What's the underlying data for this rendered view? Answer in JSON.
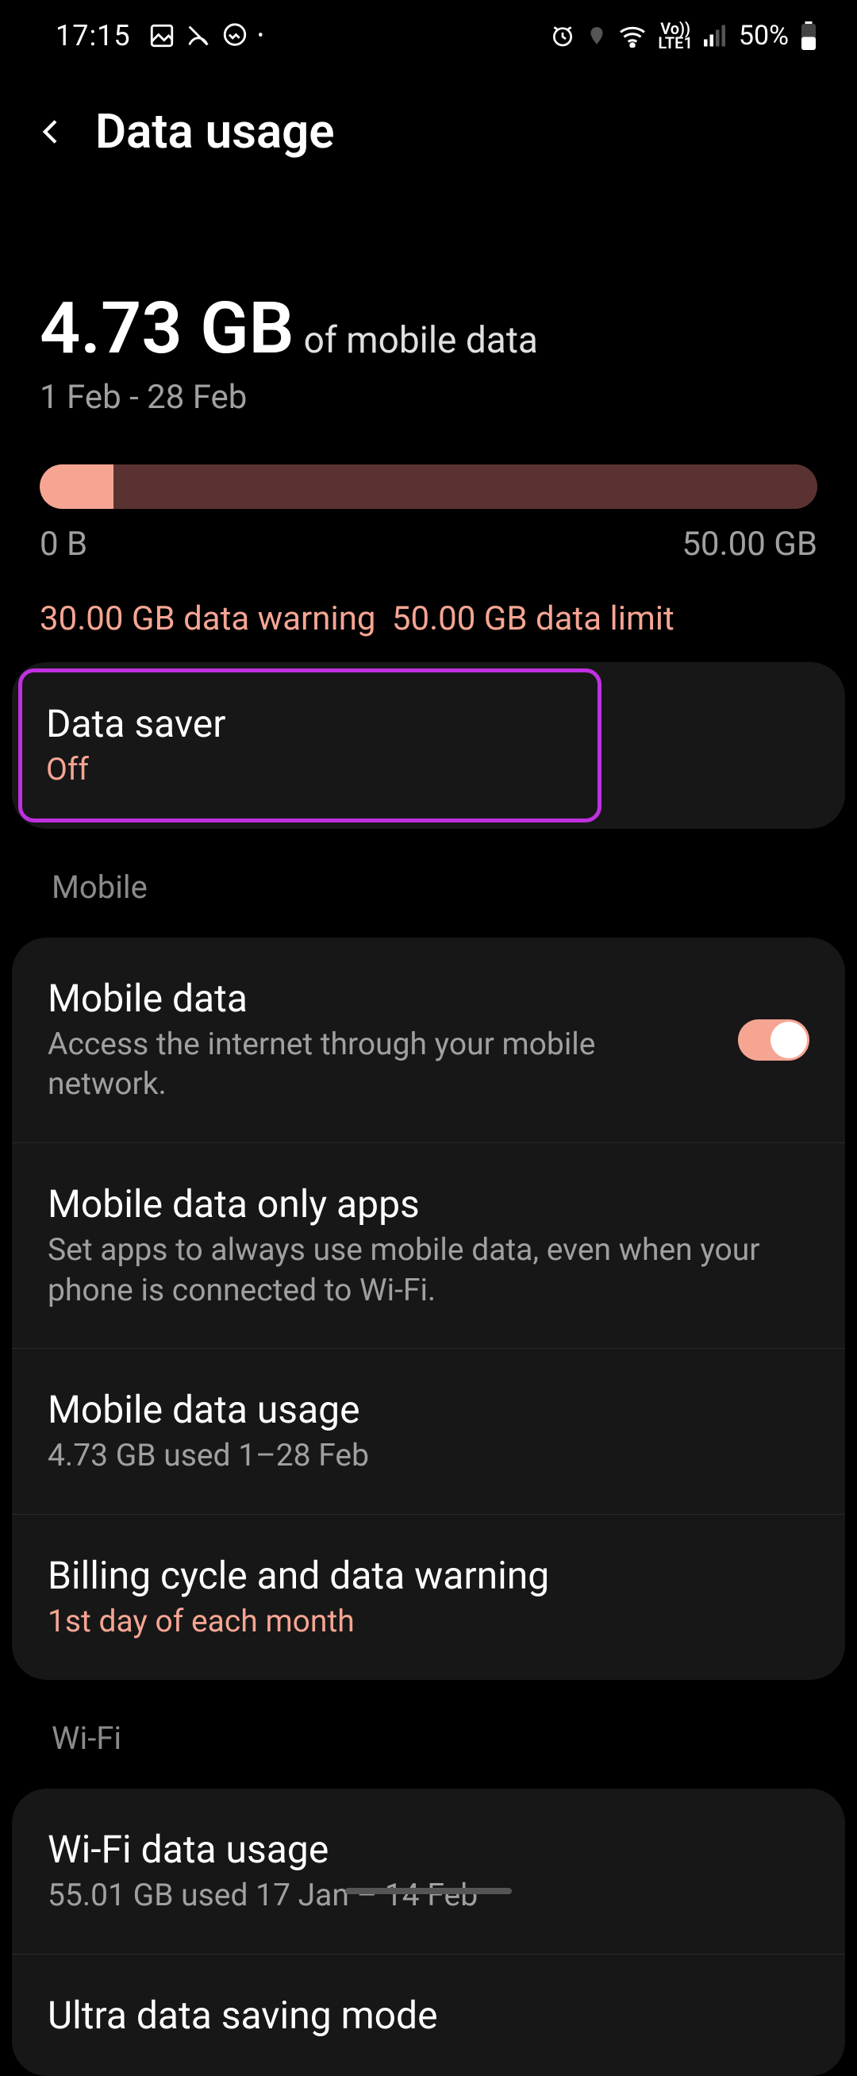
{
  "statusbar": {
    "time": "17:15",
    "battery_percent": "50%",
    "network_label": "LTE1",
    "volte_label": "Vo))"
  },
  "header": {
    "title": "Data usage"
  },
  "summary": {
    "amount": "4.73 GB",
    "of_label": "of mobile data",
    "date_range": "1 Feb - 28 Feb",
    "bar_min": "0 B",
    "bar_max": "50.00 GB",
    "warning_text": "30.00 GB data warning",
    "limit_text": "50.00 GB data limit",
    "used_gb": 4.73,
    "limit_gb": 50.0,
    "warning_gb": 30.0
  },
  "data_saver": {
    "title": "Data saver",
    "status": "Off"
  },
  "sections": {
    "mobile_label": "Mobile",
    "wifi_label": "Wi-Fi"
  },
  "mobile": {
    "mobile_data": {
      "title": "Mobile data",
      "subtitle": "Access the internet through your mobile network.",
      "on": true
    },
    "mobile_data_only_apps": {
      "title": "Mobile data only apps",
      "subtitle": "Set apps to always use mobile data, even when your phone is connected to Wi-Fi."
    },
    "mobile_data_usage": {
      "title": "Mobile data usage",
      "subtitle": "4.73 GB used 1–28 Feb"
    },
    "billing_cycle": {
      "title": "Billing cycle and data warning",
      "subtitle": "1st day of each month"
    }
  },
  "wifi": {
    "wifi_data_usage": {
      "title": "Wi-Fi data usage",
      "subtitle": "55.01 GB used 17 Jan – 14 Feb"
    },
    "ultra_saving": {
      "title": "Ultra data saving mode"
    }
  }
}
